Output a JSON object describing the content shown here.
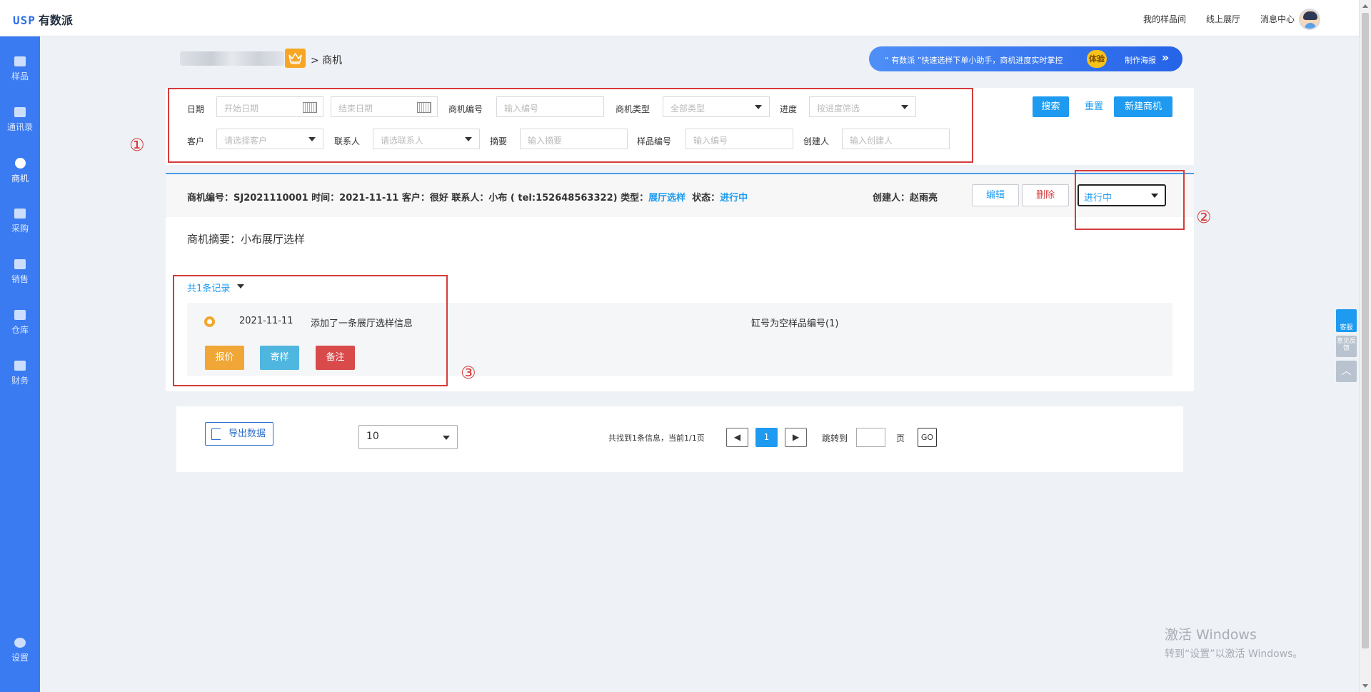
{
  "header": {
    "logo_mark": "USP",
    "logo_text": "有数派",
    "nav": [
      "我的样品间",
      "线上展厅",
      "消息中心"
    ]
  },
  "sidebar": {
    "items": [
      {
        "label": "样品",
        "icon": "sample-icon"
      },
      {
        "label": "通讯录",
        "icon": "contacts-icon"
      },
      {
        "label": "商机",
        "icon": "opportunity-icon",
        "active": true
      },
      {
        "label": "采购",
        "icon": "purchase-icon"
      },
      {
        "label": "销售",
        "icon": "sales-icon"
      },
      {
        "label": "仓库",
        "icon": "warehouse-icon"
      },
      {
        "label": "财务",
        "icon": "finance-icon"
      }
    ],
    "settings": {
      "label": "设置",
      "icon": "settings-icon"
    }
  },
  "breadcrumb": {
    "current": "> 商机"
  },
  "banner": {
    "text": "“ 有数派 ”快速选样下单小助手，商机进度实时掌控",
    "badge": "体验",
    "poster": "制作海报"
  },
  "filters": {
    "date_label": "日期",
    "start_date_placeholder": "开始日期",
    "end_date_placeholder": "结束日期",
    "code_label": "商机编号",
    "code_placeholder": "输入编号",
    "type_label": "商机类型",
    "type_value": "全部类型",
    "progress_label": "进度",
    "progress_placeholder": "按进度筛选",
    "customer_label": "客户",
    "customer_placeholder": "请选择客户",
    "contact_label": "联系人",
    "contact_placeholder": "请选联系人",
    "summary_label": "摘要",
    "summary_placeholder": "输入摘要",
    "sample_label": "样品编号",
    "sample_placeholder": "输入编号",
    "creator_label": "创建人",
    "creator_placeholder": "输入创建人",
    "search_btn": "搜索",
    "reset_btn": "重置",
    "new_btn": "新建商机"
  },
  "annotations": [
    "①",
    "②",
    "③"
  ],
  "opportunity": {
    "info_prefix": "商机编号：SJ2021110001  时间：2021-11-11  客户：很好  联系人：小布 ( tel:152648563322)  类型：",
    "type_value": "展厅选样",
    "status_label": "  状态：",
    "status_value": "进行中",
    "creator": "创建人：赵雨亮",
    "edit_btn": "编辑",
    "delete_btn": "删除",
    "status_select": "进行中",
    "summary": "商机摘要：小布展厅选样",
    "records_toggle": "共1条记录",
    "record": {
      "date": "2021-11-11",
      "text": "添加了一条展厅选样信息",
      "right_text": "缸号为空样品编号(1)",
      "quote_btn": "报价",
      "send_btn": "寄样",
      "note_btn": "备注"
    }
  },
  "pagination": {
    "export_btn": "导出数据",
    "page_size": "10",
    "info": "共找到1条信息，当前1/1页",
    "current_page": "1",
    "jump_label": "跳转到",
    "page_unit": "页",
    "go_btn": "GO"
  },
  "float_tools": {
    "service": "客服",
    "feedback": "意见反馈"
  },
  "watermark": {
    "line1": "激活 Windows",
    "line2": "转到“设置”以激活 Windows。"
  },
  "colors": {
    "sidebar": "#3a7bf2",
    "primary": "#1e9bf0",
    "annotation_red": "#d63b3b",
    "quote": "#f0a737",
    "send": "#4fb6e0",
    "note": "#d94a4a"
  }
}
